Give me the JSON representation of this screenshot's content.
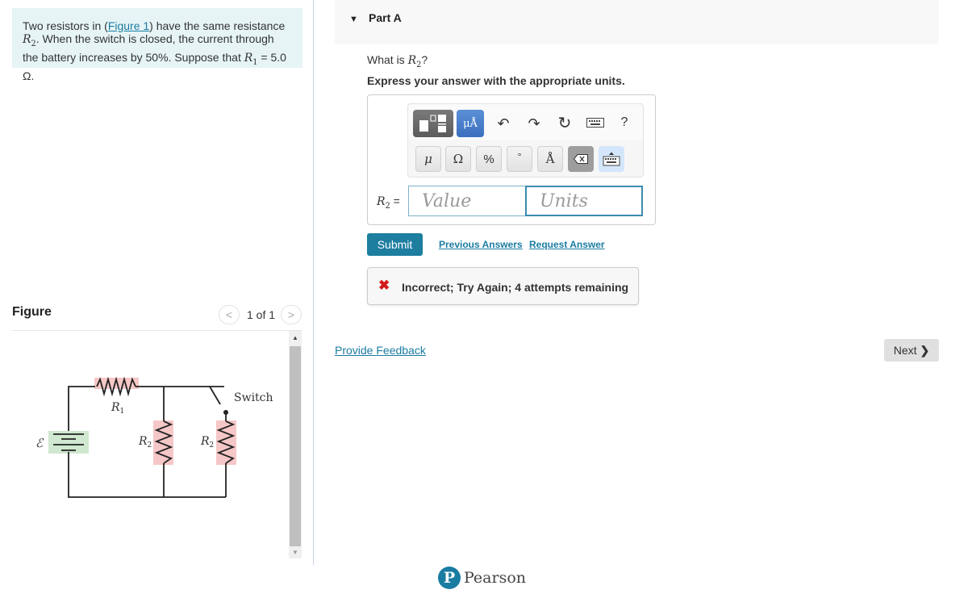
{
  "problem": {
    "text_before_link": "Two resistors in (",
    "link": "Figure 1",
    "text_after_link": ") have the same resistance ",
    "r2_symbol": "R",
    "r2_sub": "2",
    "line2": ". When the switch is closed, the current through the battery increases by 50%. Suppose that ",
    "r1_symbol": "R",
    "r1_sub": "1",
    "r1_value": " = 5.0 Ω."
  },
  "figure": {
    "title": "Figure",
    "pager": {
      "prev": "<",
      "label": "1 of 1",
      "next": ">"
    },
    "scroll": {
      "up": "▲",
      "down": "▼"
    },
    "circuit": {
      "emf_label": "ℰ",
      "r1_label": "R",
      "r1_sub": "1",
      "r2_label": "R",
      "r2_sub": "2",
      "switch_label": "Switch",
      "colors": {
        "resistor_bg": "#f6c7c7",
        "battery_bg": "#cfe8cf",
        "wire": "#222222"
      }
    }
  },
  "part": {
    "caret": "▼",
    "title": "Part A",
    "question_prefix": "What is ",
    "question_var": "R",
    "question_sub": "2",
    "question_suffix": "?",
    "instruction": "Express your answer with the appropriate units."
  },
  "answer": {
    "toolbar": {
      "units": "μÅ",
      "undo": "↶",
      "redo": "↷",
      "reset": "↻",
      "help": "?",
      "symbols": {
        "mu": "μ",
        "omega": "Ω",
        "percent": "%",
        "degree": "°",
        "angstrom": "Å",
        "backspace": "⌫"
      }
    },
    "label_var": "R",
    "label_sub": "2",
    "label_eq": " =",
    "value_placeholder": "Value",
    "value": "",
    "units_placeholder": "Units",
    "units_value": ""
  },
  "actions": {
    "submit": "Submit",
    "previous_answers": "Previous Answers",
    "request_answer": "Request Answer"
  },
  "feedback": {
    "icon": "✖",
    "text": "Incorrect; Try Again; 4 attempts remaining",
    "color": "#d31b1b"
  },
  "footer": {
    "provide_feedback": "Provide Feedback",
    "next": "Next",
    "next_chevron": "❯",
    "brand_logo": "P",
    "brand": "Pearson",
    "brand_color": "#1a7ca1"
  }
}
